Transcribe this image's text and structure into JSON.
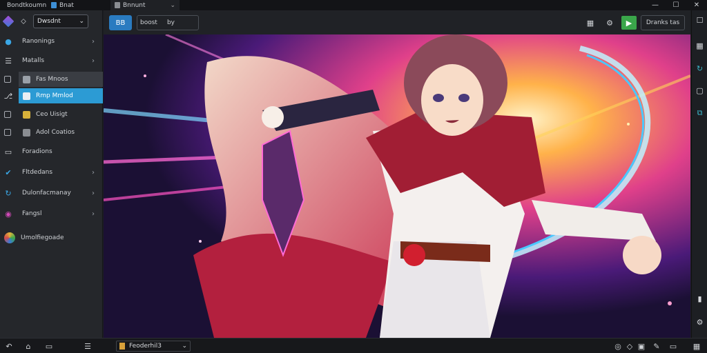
{
  "titlebar": {
    "tabs": [
      {
        "label": "Bondtkoumn",
        "icon": "app-logo-icon"
      },
      {
        "label": "Bnat",
        "icon": "doc-icon"
      },
      {
        "label": "Bnnunt",
        "icon": "doc-icon"
      }
    ],
    "controls": {
      "min": "—",
      "max": "☐",
      "close": "✕"
    }
  },
  "sidebar": {
    "selector": {
      "value": "Dwsdnt"
    },
    "items": [
      {
        "label": "Ranonings"
      },
      {
        "label": "Matalls"
      },
      {
        "label": "Fas Mnoos"
      },
      {
        "label": "Rmp Mmlod"
      },
      {
        "label": "Ceo Uisigt"
      },
      {
        "label": "Adol Coatios"
      },
      {
        "label": "Foradions"
      },
      {
        "label": "Fltdedans"
      },
      {
        "label": "Dulonfacmanay"
      },
      {
        "label": "Fangsl"
      },
      {
        "label": "Umolfiegoade"
      }
    ]
  },
  "toolbar": {
    "blue_button": "BB",
    "field_label": "boost",
    "field_value": "by",
    "right_box": "Dranks tas"
  },
  "statusbar": {
    "file_label": "Feoderhil3"
  },
  "colors": {
    "accent": "#2c9bd4",
    "toolbar_blue": "#2a7bc0",
    "green": "#3aa64a",
    "background": "#1b1d21"
  }
}
